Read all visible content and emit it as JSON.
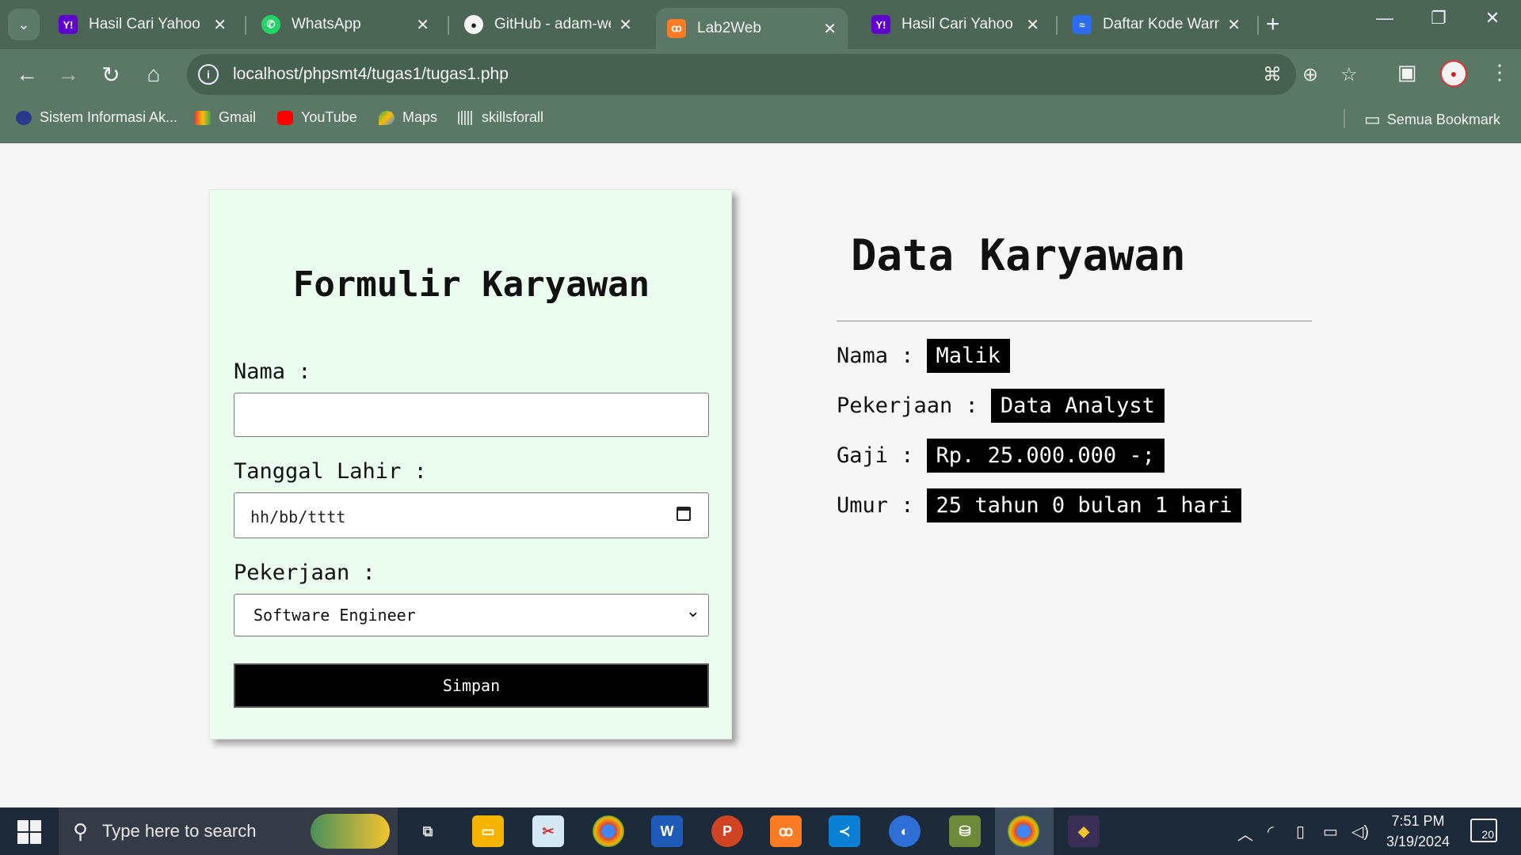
{
  "browser": {
    "tabs": [
      {
        "title": "Hasil Cari Yahoo untuk",
        "favicon": "yahoo-icon",
        "active": false
      },
      {
        "title": "WhatsApp",
        "favicon": "whatsapp-icon",
        "active": false
      },
      {
        "title": "GitHub - adam-web",
        "favicon": "github-icon",
        "active": false
      },
      {
        "title": "Lab2Web",
        "favicon": "xampp-icon",
        "active": true
      },
      {
        "title": "Hasil Cari Yahoo untuk",
        "favicon": "yahoo-icon",
        "active": false
      },
      {
        "title": "Daftar Kode Warna",
        "favicon": "site-icon",
        "active": false
      }
    ],
    "url": "localhost/phpsmt4/tugas1/tugas1.php",
    "bookmarks": [
      {
        "label": "Sistem Informasi Ak...",
        "icon": "university-icon"
      },
      {
        "label": "Gmail",
        "icon": "gmail-icon"
      },
      {
        "label": "YouTube",
        "icon": "youtube-icon"
      },
      {
        "label": "Maps",
        "icon": "maps-icon"
      },
      {
        "label": "skillsforall",
        "icon": "cisco-icon"
      }
    ],
    "all_bookmarks": "Semua Bookmark"
  },
  "form": {
    "title": "Formulir Karyawan",
    "nama_label": "Nama :",
    "nama_value": "",
    "tanggal_label": "Tanggal Lahir :",
    "tanggal_placeholder": "hh/bb/tttt",
    "pekerjaan_label": "Pekerjaan :",
    "pekerjaan_selected": "Software Engineer",
    "submit_label": "Simpan"
  },
  "data": {
    "title": "Data Karyawan",
    "rows": [
      {
        "label": "Nama :",
        "value": "Malik"
      },
      {
        "label": "Pekerjaan :",
        "value": "Data Analyst"
      },
      {
        "label": "Gaji :",
        "value": "Rp. 25.000.000 -;"
      },
      {
        "label": "Umur :",
        "value": "25 tahun 0 bulan 1 hari"
      }
    ]
  },
  "taskbar": {
    "search_placeholder": "Type here to search",
    "time": "7:51 PM",
    "date": "3/19/2024",
    "notification_count": "20"
  },
  "colors": {
    "chrome_bg": "#5b7765",
    "form_bg": "#eafdee",
    "value_bg": "#000000",
    "taskbar_bg": "#1d2a3a"
  }
}
